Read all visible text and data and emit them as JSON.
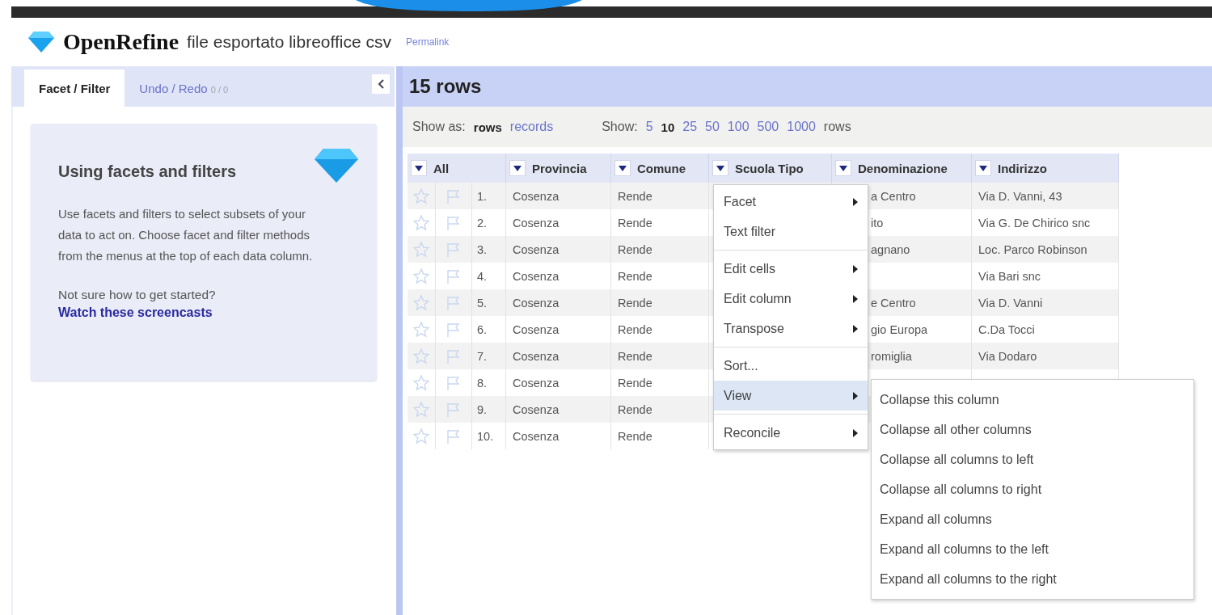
{
  "header": {
    "logo": "OpenRefine",
    "project_name": "file esportato libreoffice csv",
    "permalink": "Permalink"
  },
  "left_panel": {
    "tabs": [
      {
        "label": "Facet / Filter",
        "selected": true
      },
      {
        "label": "Undo / Redo",
        "count": "0 / 0",
        "selected": false
      }
    ],
    "help": {
      "title": "Using facets and filters",
      "body": "Use facets and filters to select subsets of your data to act on. Choose facet and filter methods from the menus at the top of each data column.",
      "question": "Not sure how to get started?",
      "link": "Watch these screencasts"
    }
  },
  "data_panel": {
    "title": "15 rows",
    "show_as": {
      "label": "Show as:",
      "options": [
        {
          "label": "rows",
          "selected": true
        },
        {
          "label": "records",
          "selected": false
        }
      ]
    },
    "page_size": {
      "label": "Show:",
      "options": [
        {
          "label": "5",
          "selected": false
        },
        {
          "label": "10",
          "selected": true
        },
        {
          "label": "25",
          "selected": false
        },
        {
          "label": "50",
          "selected": false
        },
        {
          "label": "100",
          "selected": false
        },
        {
          "label": "500",
          "selected": false
        },
        {
          "label": "1000",
          "selected": false
        }
      ],
      "suffix": "rows"
    },
    "table": {
      "columns": [
        "All",
        "Provincia",
        "Comune",
        "Scuola Tipo",
        "Denominazione",
        "Indirizzo"
      ],
      "rows": [
        {
          "index": "1.",
          "provincia": "Cosenza",
          "comune": "Rende",
          "denominazione": "a Centro",
          "indirizzo": "Via D. Vanni, 43"
        },
        {
          "index": "2.",
          "provincia": "Cosenza",
          "comune": "Rende",
          "denominazione": "ito",
          "indirizzo": "Via G. De Chirico snc"
        },
        {
          "index": "3.",
          "provincia": "Cosenza",
          "comune": "Rende",
          "denominazione": "agnano",
          "indirizzo": "Loc. Parco Robinson"
        },
        {
          "index": "4.",
          "provincia": "Cosenza",
          "comune": "Rende",
          "indirizzo": "Via Bari snc"
        },
        {
          "index": "5.",
          "provincia": "Cosenza",
          "comune": "Rende",
          "denominazione": "e Centro",
          "indirizzo": "Via D. Vanni"
        },
        {
          "index": "6.",
          "provincia": "Cosenza",
          "comune": "Rende",
          "denominazione": "gio Europa",
          "indirizzo": "C.Da Tocci"
        },
        {
          "index": "7.",
          "provincia": "Cosenza",
          "comune": "Rende",
          "denominazione": "romiglia",
          "indirizzo": "Via Dodaro"
        },
        {
          "index": "8.",
          "provincia": "Cosenza",
          "comune": "Rende"
        },
        {
          "index": "9.",
          "provincia": "Cosenza",
          "comune": "Rende"
        },
        {
          "index": "10.",
          "provincia": "Cosenza",
          "comune": "Rende"
        }
      ]
    },
    "column_menu": {
      "groups": [
        [
          {
            "label": "Facet",
            "submenu": true,
            "selected": false
          },
          {
            "label": "Text filter",
            "submenu": false,
            "selected": false
          }
        ],
        [
          {
            "label": "Edit cells",
            "submenu": true,
            "selected": false
          },
          {
            "label": "Edit column",
            "submenu": true,
            "selected": false
          },
          {
            "label": "Transpose",
            "submenu": true,
            "selected": false
          }
        ],
        [
          {
            "label": "Sort...",
            "submenu": false,
            "selected": false
          },
          {
            "label": "View",
            "submenu": true,
            "selected": true
          }
        ],
        [
          {
            "label": "Reconcile",
            "submenu": true,
            "selected": false
          }
        ]
      ],
      "submenu": [
        "Collapse this column",
        "Collapse all other columns",
        "Collapse all columns to left",
        "Collapse all columns to right",
        "Expand all columns",
        "Expand all columns to the left",
        "Expand all columns to the right"
      ]
    }
  }
}
